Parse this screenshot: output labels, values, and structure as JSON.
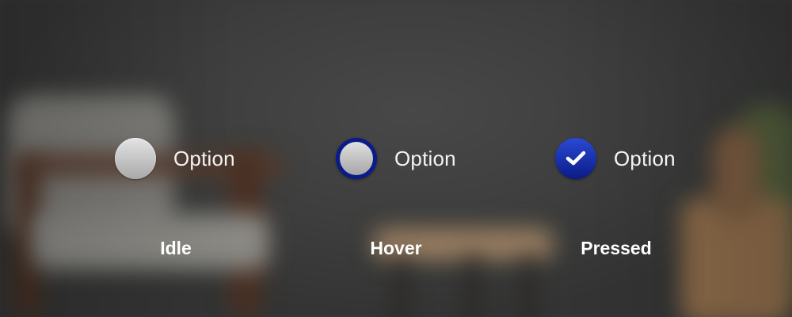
{
  "radios": [
    {
      "state": "idle",
      "label": "Option",
      "caption": "Idle"
    },
    {
      "state": "hover",
      "label": "Option",
      "caption": "Hover"
    },
    {
      "state": "pressed",
      "label": "Option",
      "caption": "Pressed"
    }
  ],
  "colors": {
    "accent": "#0b1b8a",
    "pressed_top": "#2a4ad4",
    "idle_fill": "#c8c8c8",
    "text": "#f4f4f4"
  },
  "icons": {
    "pressed_glyph": "checkmark-icon"
  }
}
